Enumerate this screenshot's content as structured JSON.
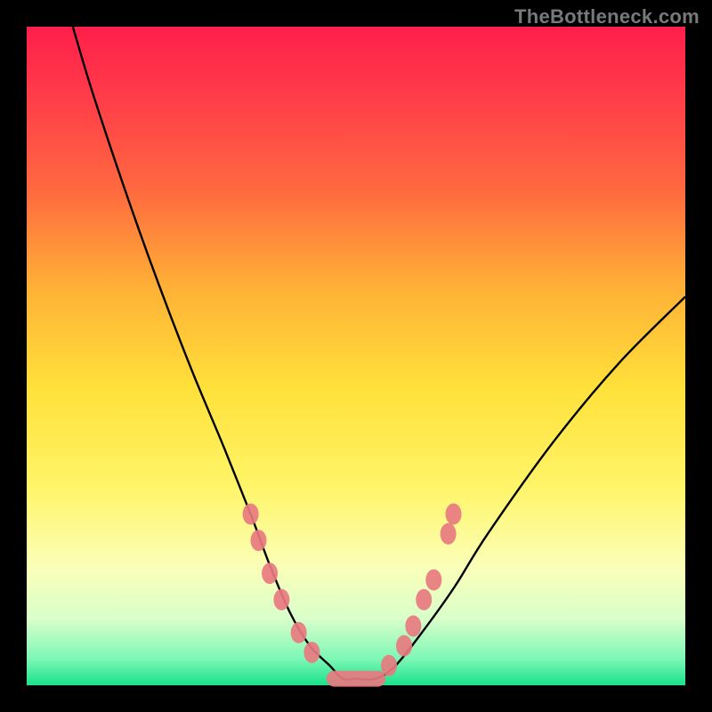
{
  "watermark": "TheBottleneck.com",
  "colors": {
    "curve_stroke": "#000000",
    "dot_fill": "#e87a80",
    "background_frame": "#000000"
  },
  "chart_data": {
    "type": "line",
    "title": "",
    "xlabel": "",
    "ylabel": "",
    "xlim": [
      0,
      100
    ],
    "ylim": [
      0,
      100
    ],
    "series": [
      {
        "name": "bottleneck-curve",
        "x": [
          7,
          10,
          15,
          20,
          25,
          30,
          34,
          37,
          40,
          43,
          46,
          48,
          50,
          53,
          56,
          60,
          65,
          70,
          80,
          90,
          100
        ],
        "y": [
          100,
          90,
          75,
          61,
          48,
          36,
          26,
          18,
          11,
          6,
          3,
          1,
          1,
          1,
          3,
          8,
          15,
          23,
          37,
          49,
          59
        ]
      }
    ],
    "markers_left": [
      {
        "x": 34.0,
        "y": 26
      },
      {
        "x": 35.2,
        "y": 22
      },
      {
        "x": 36.9,
        "y": 17
      },
      {
        "x": 38.7,
        "y": 13
      },
      {
        "x": 41.3,
        "y": 8
      },
      {
        "x": 43.3,
        "y": 5
      }
    ],
    "markers_right": [
      {
        "x": 55.0,
        "y": 3
      },
      {
        "x": 57.3,
        "y": 6
      },
      {
        "x": 58.7,
        "y": 9
      },
      {
        "x": 60.3,
        "y": 13
      },
      {
        "x": 61.8,
        "y": 16
      },
      {
        "x": 64.0,
        "y": 23
      },
      {
        "x": 64.8,
        "y": 26
      }
    ],
    "flat_segment": {
      "x_start": 45.5,
      "x_end": 54.5,
      "y": 1
    }
  }
}
